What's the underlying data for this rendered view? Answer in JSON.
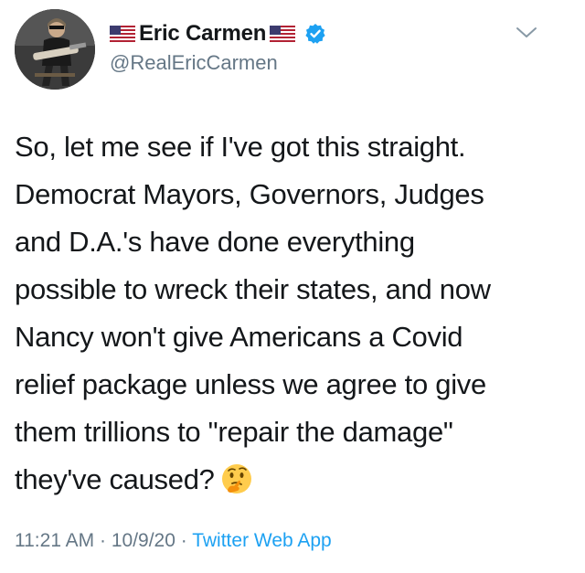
{
  "header": {
    "display_name": "Eric Carmen",
    "handle": "@RealEricCarmen"
  },
  "icons": {
    "flag_left": "us-flag-icon",
    "flag_right": "us-flag-icon",
    "verified": "verified-badge-icon",
    "menu": "chevron-down-icon",
    "emoji": "thinking-face-emoji"
  },
  "body": {
    "lines": [
      "So, let me see if I've got this straight.",
      "Democrat Mayors, Governors, Judges",
      "and D.A.'s have done everything",
      "possible to wreck their states, and now",
      "Nancy won't give Americans a Covid",
      "relief package unless we agree to give",
      "them trillions to \"repair the damage\"",
      "they've caused?"
    ]
  },
  "meta": {
    "time": "11:21 AM",
    "separator1": " · ",
    "date": "10/9/20",
    "separator2": " · ",
    "source": "Twitter Web App"
  },
  "colors": {
    "text": "#14171a",
    "secondary": "#657786",
    "link": "#1da1f2",
    "verified": "#1da1f2"
  }
}
